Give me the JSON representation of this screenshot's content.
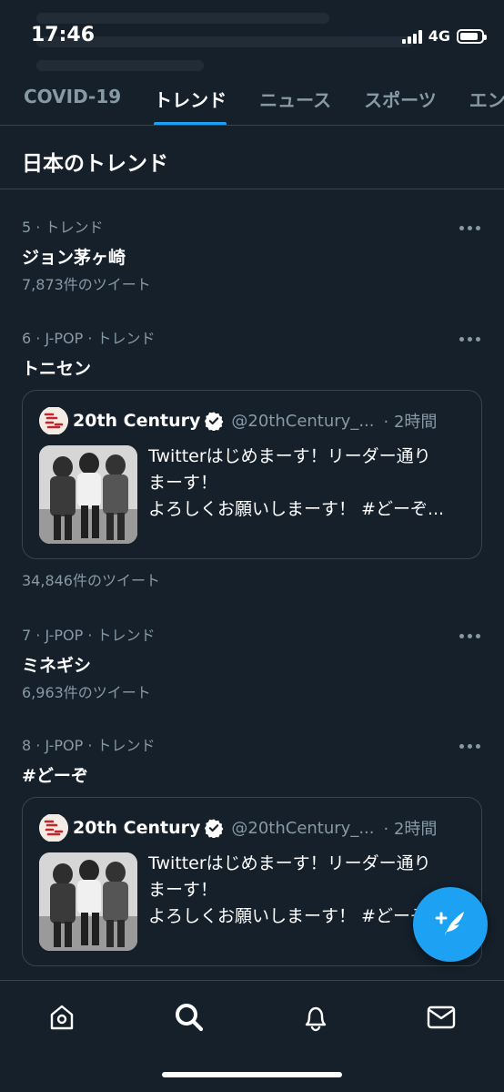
{
  "status_bar": {
    "time": "17:46",
    "network": "4G",
    "battery_percent": 85
  },
  "tabs": [
    {
      "label": "COVID-19",
      "active": false
    },
    {
      "label": "トレンド",
      "active": true
    },
    {
      "label": "ニュース",
      "active": false
    },
    {
      "label": "スポーツ",
      "active": false
    },
    {
      "label": "エン",
      "active": false
    }
  ],
  "section_title": "日本のトレンド",
  "trends": [
    {
      "meta": "5 · トレンド",
      "name": "ジョン茅ヶ崎",
      "count": "7,873件のツイート"
    },
    {
      "meta": "6 · J-POP · トレンド",
      "name": "トニセン",
      "count": "34,846件のツイート"
    },
    {
      "meta": "7 · J-POP · トレンド",
      "name": "ミネギシ",
      "count": "6,963件のツイート"
    },
    {
      "meta": "8 · J-POP · トレンド",
      "name": "#どーぞ",
      "count": ""
    }
  ],
  "cards": [
    {
      "name": "20th Century",
      "handle": "@20thCentury_...",
      "time": "· 2時間",
      "lines": [
        "Twitterはじめまーす！リーダー通り",
        "まーす！",
        "よろしくお願いしまーす！ #どーぞ..."
      ]
    },
    {
      "name": "20th Century",
      "handle": "@20thCentury_...",
      "time": "· 2時間",
      "lines": [
        "Twitterはじめまーす！リーダー通り",
        "まーす！",
        "よろしくお願いしまーす！ #どーぞ..."
      ]
    }
  ],
  "colors": {
    "background": "#15202b",
    "accent": "#1da1f2",
    "secondary_text": "#8899a6",
    "border": "#38444d"
  },
  "icons": {
    "verified": "verified-badge-icon",
    "fab": "compose-tweet-icon",
    "nav": [
      "home-icon",
      "search-icon",
      "notifications-bell-icon",
      "messages-mail-icon"
    ]
  }
}
